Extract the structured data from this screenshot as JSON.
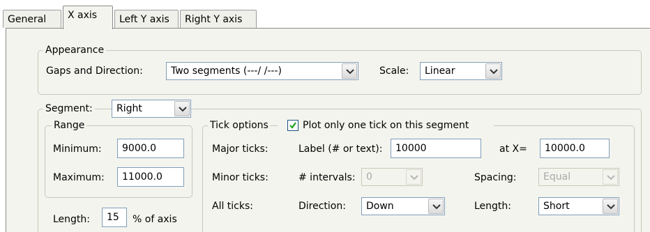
{
  "tabs": [
    {
      "label": "General",
      "active": false
    },
    {
      "label": "X axis",
      "active": true
    },
    {
      "label": "Left Y axis",
      "active": false
    },
    {
      "label": "Right Y axis",
      "active": false
    }
  ],
  "appearance": {
    "title": "Appearance",
    "gaps_label": "Gaps and Direction:",
    "gaps_value": "Two segments (---/ /---)",
    "scale_label": "Scale:",
    "scale_value": "Linear"
  },
  "segment": {
    "label": "Segment:",
    "value": "Right"
  },
  "range": {
    "title": "Range",
    "minimum_label": "Minimum:",
    "minimum_value": "9000.0",
    "maximum_label": "Maximum:",
    "maximum_value": "11000.0"
  },
  "length": {
    "label": "Length:",
    "value": "15",
    "suffix": "% of axis"
  },
  "tick_options": {
    "title": "Tick options",
    "one_tick_label": "Plot only one tick on this segment",
    "one_tick_checked": true,
    "major_ticks_label": "Major ticks:",
    "label_text_label": "Label (# or text):",
    "label_text_value": "10000",
    "at_x_label": "at X=",
    "at_x_value": "10000.0",
    "minor_ticks_label": "Minor ticks:",
    "intervals_label": "# intervals:",
    "intervals_value": "0",
    "spacing_label": "Spacing:",
    "spacing_value": "Equal",
    "all_ticks_label": "All ticks:",
    "direction_label": "Direction:",
    "direction_value": "Down",
    "tick_length_label": "Length:",
    "tick_length_value": "Short"
  },
  "icons": {
    "dropdown": "chevron-down-icon",
    "check": "checkmark-icon"
  },
  "colors": {
    "panel_bg": "#f4f4ee",
    "field_border": "#7f9db9",
    "group_border": "#c9c7b8",
    "disabled_text": "#a8a8a8",
    "checkbox_border": "#1c5180"
  }
}
